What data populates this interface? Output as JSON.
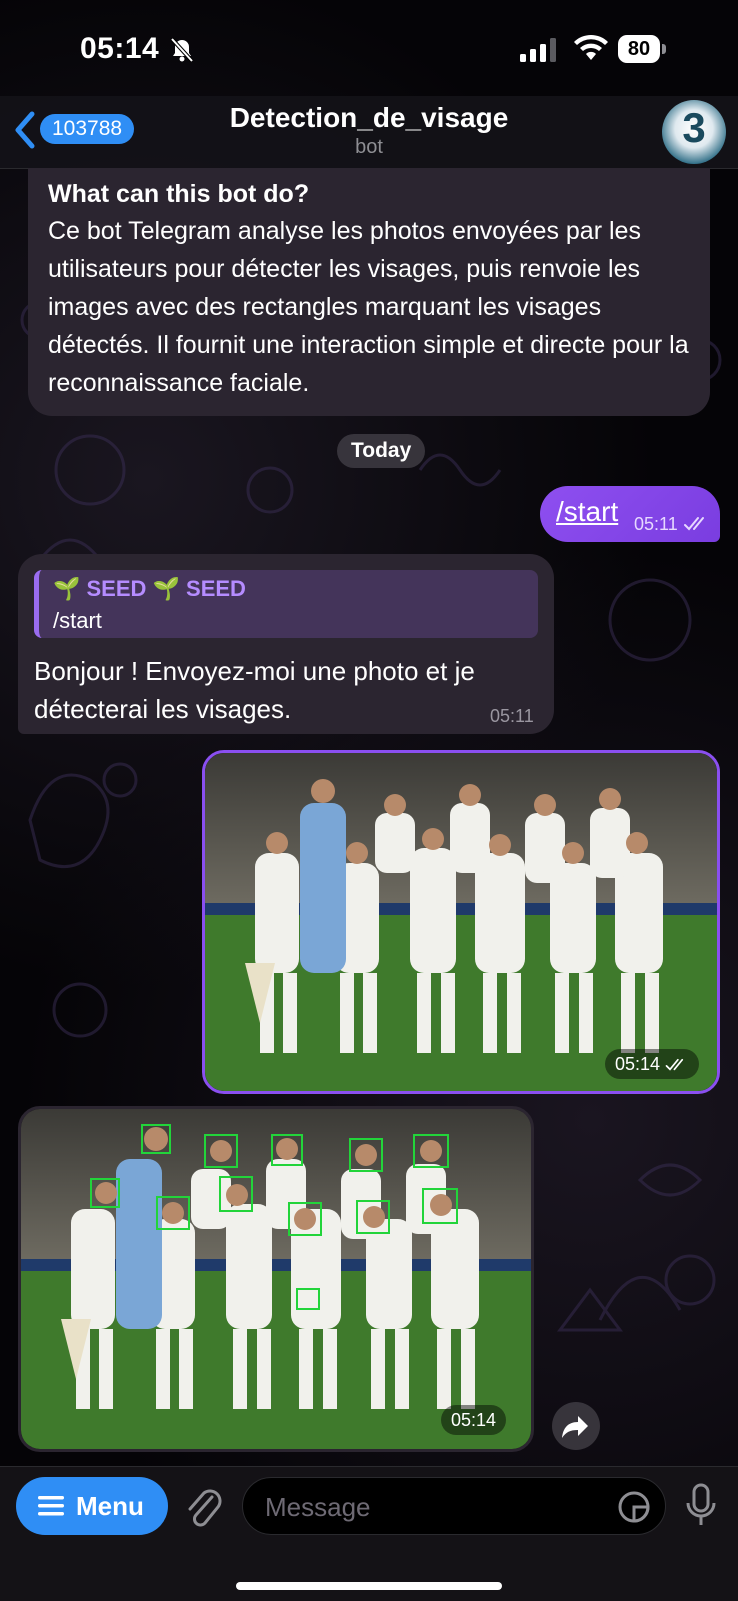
{
  "status": {
    "time": "05:14",
    "battery": "80"
  },
  "header": {
    "back_count": "103788",
    "title": "Detection_de_visage",
    "subtitle": "bot"
  },
  "info": {
    "title": "What can this bot do?",
    "text": "Ce bot Telegram analyse les photos envoyées par les utilisateurs pour détecter les visages, puis renvoie les images avec des rectangles marquant les visages détectés. Il fournit une interaction simple et directe pour la reconnaissance faciale."
  },
  "date_pill": "Today",
  "messages": {
    "out_start": {
      "text": "/start",
      "time": "05:11"
    },
    "reply": {
      "quote_name": "🌱 SEED 🌱 SEED",
      "quote_text": "/start",
      "text": "Bonjour ! Envoyez-moi une photo et je détecterai les visages.",
      "time": "05:11"
    },
    "photo_out": {
      "time": "05:14"
    },
    "photo_in": {
      "time": "05:14"
    }
  },
  "input": {
    "menu_label": "Menu",
    "placeholder": "Message"
  },
  "colors": {
    "accent": "#2f8ef5",
    "outgoing": "#8a4ff0",
    "incoming": "#2b2530",
    "face_box": "#22d43a"
  },
  "icons": [
    "bell-slash-icon",
    "signal-icon",
    "wifi-icon",
    "chevron-left-icon",
    "checkmarks-icon",
    "share-icon",
    "menu-icon",
    "paperclip-icon",
    "sticker-icon",
    "microphone-icon"
  ]
}
